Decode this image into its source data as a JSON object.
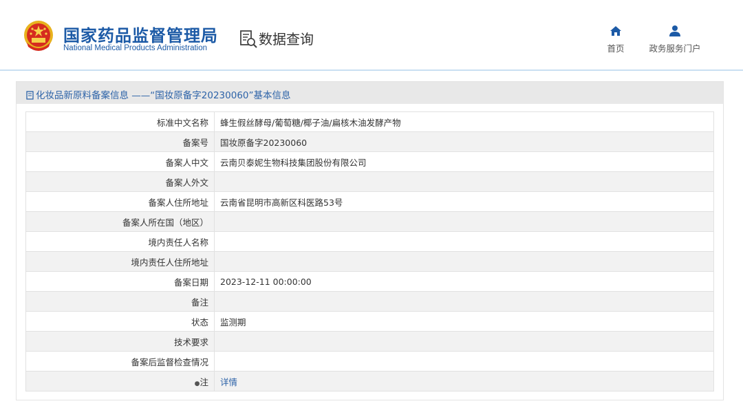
{
  "header": {
    "brand_cn": "国家药品监督管理局",
    "brand_en": "National Medical Products Administration",
    "query_label": "数据查询",
    "nav": [
      {
        "label": "首页",
        "icon": "home-icon"
      },
      {
        "label": "政务服务门户",
        "icon": "user-icon"
      }
    ]
  },
  "panel": {
    "title": "化妆品新原料备案信息 ——“国妆原备字20230060”基本信息"
  },
  "rows": [
    {
      "label": "标准中文名称",
      "value": "蜂生假丝酵母/葡萄糖/椰子油/扁核木油发酵产物"
    },
    {
      "label": "备案号",
      "value": "国妆原备字20230060"
    },
    {
      "label": "备案人中文",
      "value": "云南贝泰妮生物科技集团股份有限公司"
    },
    {
      "label": "备案人外文",
      "value": ""
    },
    {
      "label": "备案人住所地址",
      "value": "云南省昆明市高新区科医路53号"
    },
    {
      "label": "备案人所在国（地区）",
      "value": ""
    },
    {
      "label": "境内责任人名称",
      "value": ""
    },
    {
      "label": "境内责任人住所地址",
      "value": ""
    },
    {
      "label": "备案日期",
      "value": "2023-12-11 00:00:00"
    },
    {
      "label": "备注",
      "value": ""
    },
    {
      "label": "状态",
      "value": "监测期"
    },
    {
      "label": "技术要求",
      "value": ""
    },
    {
      "label": "备案后监督检查情况",
      "value": ""
    },
    {
      "label": "注",
      "value": "详情"
    }
  ],
  "colors": {
    "brand_blue": "#1c5aa6",
    "link_blue": "#2d63a8",
    "title_bar": "#e8e8e8"
  }
}
